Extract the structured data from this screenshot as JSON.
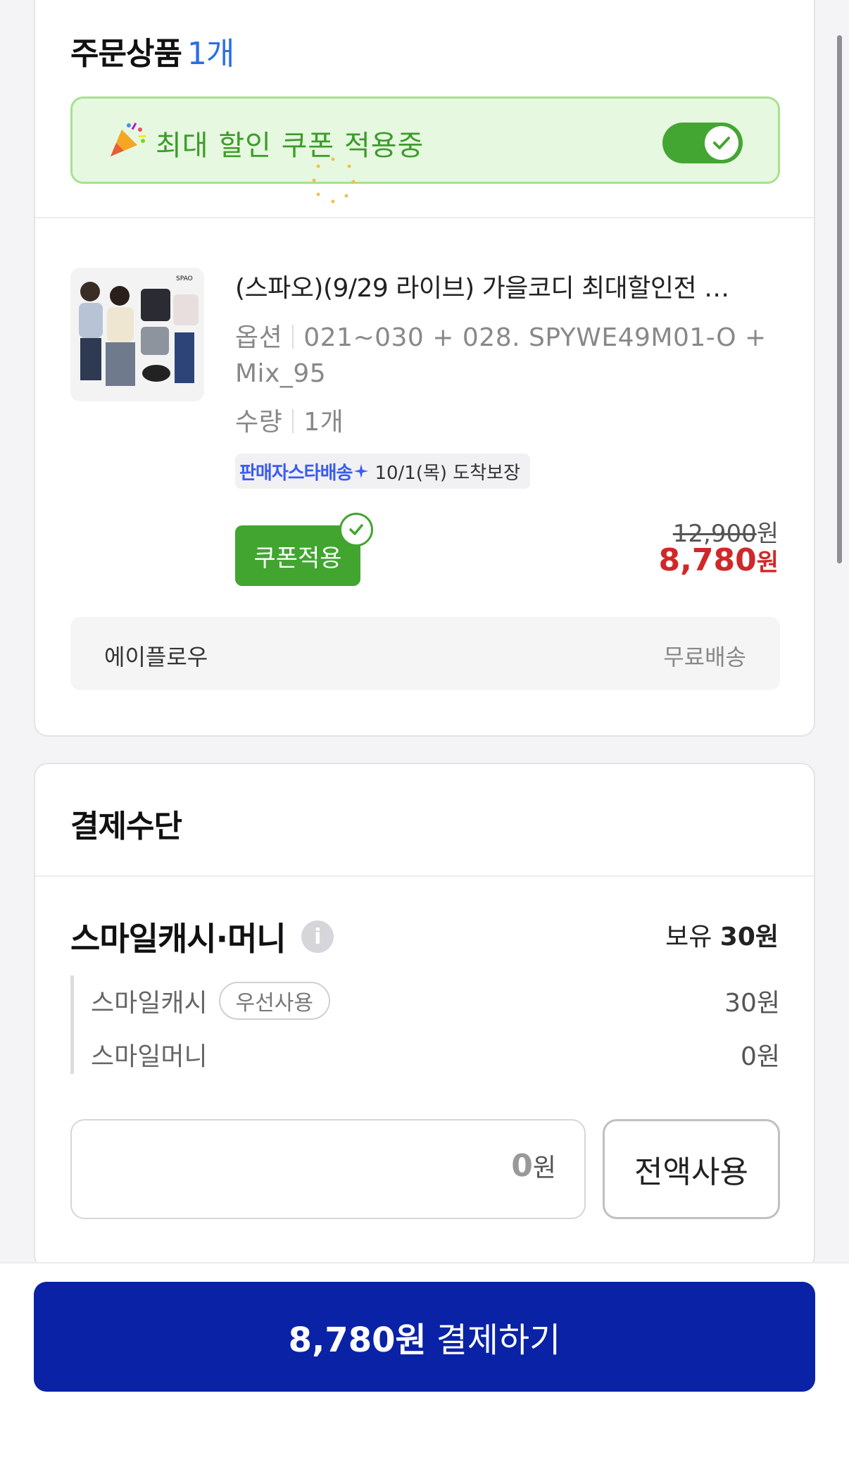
{
  "order": {
    "title": "주문상품",
    "count": "1개",
    "coupon_banner_text": "최대 할인 쿠폰 적용중",
    "coupon_toggle_on": true,
    "product": {
      "title": "(스파오)(9/29 라이브) 가을코디 최대할인전 …",
      "option_label": "옵션",
      "option_value_line1": "021~030 + 028. SPYWE49M01-O +",
      "option_value_line2": "Mix_95",
      "qty_label": "수량",
      "qty_value": "1개",
      "delivery_brand": "판매자스타배송",
      "delivery_date": "10/1(목) 도착보장",
      "coupon_button": "쿠폰적용",
      "original_price": "12,900",
      "original_unit": "원",
      "final_price": "8,780",
      "final_unit": "원"
    },
    "seller": {
      "name": "에이플로우",
      "shipping": "무료배송"
    }
  },
  "payment": {
    "title": "결제수단",
    "smile": {
      "title": "스마일캐시·머니",
      "holding_label": "보유",
      "holding_value": "30원",
      "cash_label": "스마일캐시",
      "cash_pill": "우선사용",
      "cash_value": "30원",
      "money_label": "스마일머니",
      "money_value": "0원"
    },
    "input": {
      "value": "0",
      "unit": "원"
    },
    "use_all_button": "전액사용"
  },
  "checkout": {
    "amount": "8,780원",
    "label": "결제하기"
  },
  "colors": {
    "accent_blue": "#2a6ee8",
    "coupon_green": "#41a530",
    "price_red": "#d0282a",
    "pay_button": "#0a22a6"
  }
}
